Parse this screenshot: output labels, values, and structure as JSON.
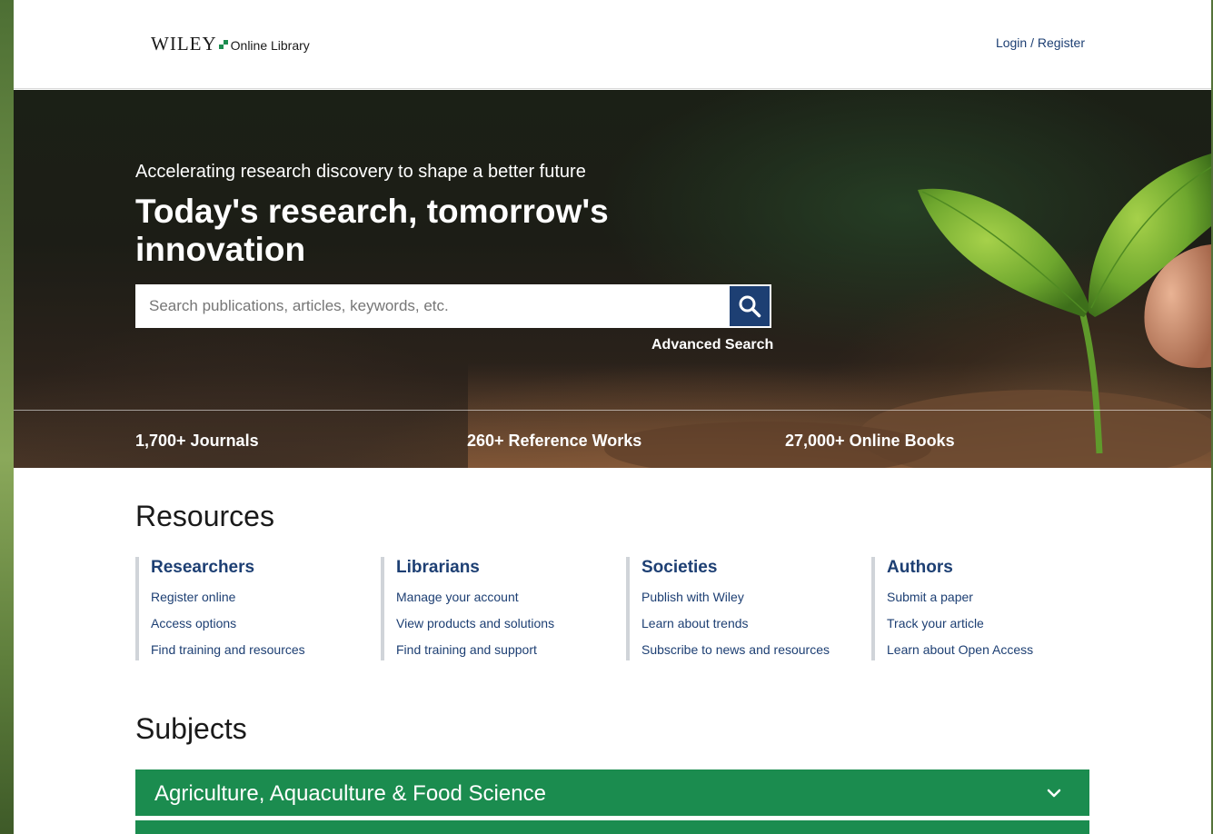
{
  "header": {
    "logo_brand": "WILEY",
    "logo_sub": "Online Library",
    "login_label": "Login / Register"
  },
  "hero": {
    "tagline": "Accelerating research discovery to shape a better future",
    "title": "Today's research, tomorrow's innovation",
    "search_placeholder": "Search publications, articles, keywords, etc.",
    "search_value": "",
    "advanced_search_label": "Advanced Search",
    "stats": [
      "1,700+ Journals",
      "260+ Reference Works",
      "27,000+ Online Books"
    ]
  },
  "resources": {
    "title": "Resources",
    "columns": [
      {
        "heading": "Researchers",
        "links": [
          "Register online",
          "Access options",
          "Find training and resources"
        ]
      },
      {
        "heading": "Librarians",
        "links": [
          "Manage your account",
          "View products and solutions",
          "Find training and support"
        ]
      },
      {
        "heading": "Societies",
        "links": [
          "Publish with Wiley",
          "Learn about trends",
          "Subscribe to news and resources"
        ]
      },
      {
        "heading": "Authors",
        "links": [
          "Submit a paper",
          "Track your article",
          "Learn about Open Access"
        ]
      }
    ]
  },
  "subjects": {
    "title": "Subjects",
    "items": [
      {
        "label": "Agriculture, Aquaculture & Food Science",
        "icon": "chevron-down-icon"
      }
    ]
  },
  "colors": {
    "brand_navy": "#1d3f73",
    "brand_green": "#1b8c4f"
  }
}
